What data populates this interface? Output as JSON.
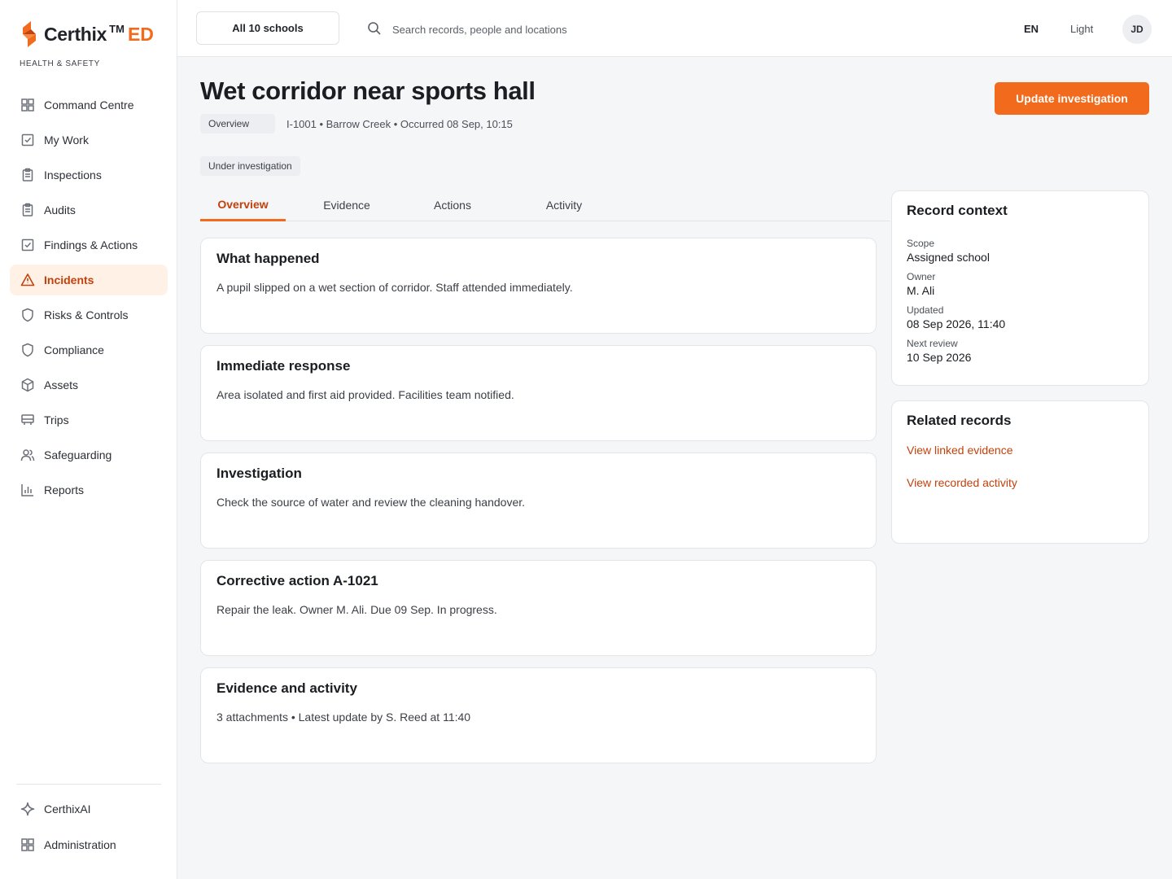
{
  "brand": {
    "name": "Certhix",
    "tm": "TM",
    "suffix": "ED",
    "subtitle": "HEALTH & SAFETY",
    "accent_color": "#f26a1b"
  },
  "sidebar": {
    "items": [
      {
        "label": "Command Centre",
        "icon": "grid-icon"
      },
      {
        "label": "My Work",
        "icon": "checkbox-icon"
      },
      {
        "label": "Inspections",
        "icon": "clipboard-icon"
      },
      {
        "label": "Audits",
        "icon": "clipboard-icon"
      },
      {
        "label": "Findings & Actions",
        "icon": "checkbox-icon"
      },
      {
        "label": "Incidents",
        "icon": "warning-triangle-icon",
        "active": true
      },
      {
        "label": "Risks & Controls",
        "icon": "shield-icon"
      },
      {
        "label": "Compliance",
        "icon": "shield-icon"
      },
      {
        "label": "Assets",
        "icon": "cube-icon"
      },
      {
        "label": "Trips",
        "icon": "bus-icon"
      },
      {
        "label": "Safeguarding",
        "icon": "users-icon"
      },
      {
        "label": "Reports",
        "icon": "bar-chart-icon"
      }
    ],
    "bottom_items": [
      {
        "label": "CerthixAI",
        "icon": "sparkle-icon"
      },
      {
        "label": "Administration",
        "icon": "grid-icon"
      }
    ]
  },
  "topbar": {
    "school_select": "All 10 schools",
    "search_placeholder": "Search records, people and locations",
    "language": "EN",
    "theme": "Light",
    "avatar_initials": "JD"
  },
  "record": {
    "title": "Wet corridor near sports hall",
    "update_button": "Update investigation",
    "breadcrumb_chip": "Overview",
    "meta": "I-1001 • Barrow Creek • Occurred 08 Sep, 10:15",
    "status": "Under investigation"
  },
  "tabs": [
    "Overview",
    "Evidence",
    "Actions",
    "Activity"
  ],
  "cards": [
    {
      "title": "What happened",
      "body": "A pupil slipped on a wet section of corridor. Staff attended immediately."
    },
    {
      "title": "Immediate response",
      "body": "Area isolated and first aid provided. Facilities team notified."
    },
    {
      "title": "Investigation",
      "body": "Check the source of water and review the cleaning handover."
    },
    {
      "title": "Corrective action A-1021",
      "body": "Repair the leak. Owner M. Ali. Due 09 Sep. In progress."
    },
    {
      "title": "Evidence and activity",
      "body": "3 attachments • Latest update by S. Reed at 11:40"
    }
  ],
  "record_context": {
    "title": "Record context",
    "rows": [
      {
        "label": "Scope",
        "value": "Assigned school"
      },
      {
        "label": "Owner",
        "value": "M. Ali"
      },
      {
        "label": "Updated",
        "value": "08 Sep 2026, 11:40"
      },
      {
        "label": "Next review",
        "value": "10 Sep 2026"
      }
    ]
  },
  "related_records": {
    "title": "Related records",
    "links": [
      "View linked evidence",
      "View recorded activity"
    ]
  }
}
